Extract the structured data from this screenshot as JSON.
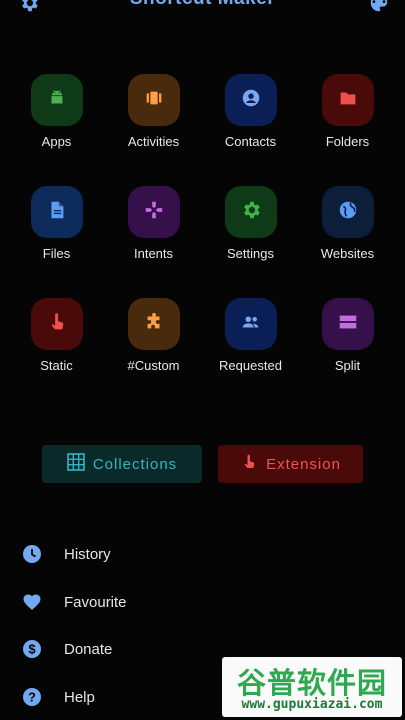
{
  "header": {
    "title": "Shortcut Maker"
  },
  "grid": [
    {
      "label": "Apps",
      "icon": "android-icon",
      "bg": "#0f3a18",
      "fg": "#4caf50"
    },
    {
      "label": "Activities",
      "icon": "activities-icon",
      "bg": "#4a2a0c",
      "fg": "#ff9f43"
    },
    {
      "label": "Contacts",
      "icon": "contact-icon",
      "bg": "#0a1f55",
      "fg": "#7aa7f0"
    },
    {
      "label": "Folders",
      "icon": "folder-icon",
      "bg": "#4a0a0a",
      "fg": "#f0504c"
    },
    {
      "label": "Files",
      "icon": "file-icon",
      "bg": "#0c2a5a",
      "fg": "#5b9cf5"
    },
    {
      "label": "Intents",
      "icon": "gamepad-icon",
      "bg": "#35104a",
      "fg": "#c76be0"
    },
    {
      "label": "Settings",
      "icon": "gear-icon",
      "bg": "#0f3a18",
      "fg": "#3db54a"
    },
    {
      "label": "Websites",
      "icon": "globe-icon",
      "bg": "#0d1e3a",
      "fg": "#5b9cf5"
    },
    {
      "label": "Static",
      "icon": "touch-icon",
      "bg": "#4a0a0a",
      "fg": "#f0504c"
    },
    {
      "label": "#Custom",
      "icon": "puzzle-icon",
      "bg": "#4a2a0c",
      "fg": "#ff9f43"
    },
    {
      "label": "Requested",
      "icon": "people-icon",
      "bg": "#0a1f55",
      "fg": "#7aa7f0"
    },
    {
      "label": "Split",
      "icon": "split-icon",
      "bg": "#35104a",
      "fg": "#c76be0"
    }
  ],
  "buttons": {
    "collections": "Collections",
    "extension": "Extension"
  },
  "menu": [
    {
      "label": "History",
      "icon": "clock-icon"
    },
    {
      "label": "Favourite",
      "icon": "heart-icon"
    },
    {
      "label": "Donate",
      "icon": "dollar-icon"
    },
    {
      "label": "Help",
      "icon": "help-icon"
    }
  ],
  "colors": {
    "accent": "#73a9f0",
    "background": "#050505"
  },
  "watermark": {
    "line1": "谷普软件园",
    "line2": "www.gupuxiazai.com"
  }
}
